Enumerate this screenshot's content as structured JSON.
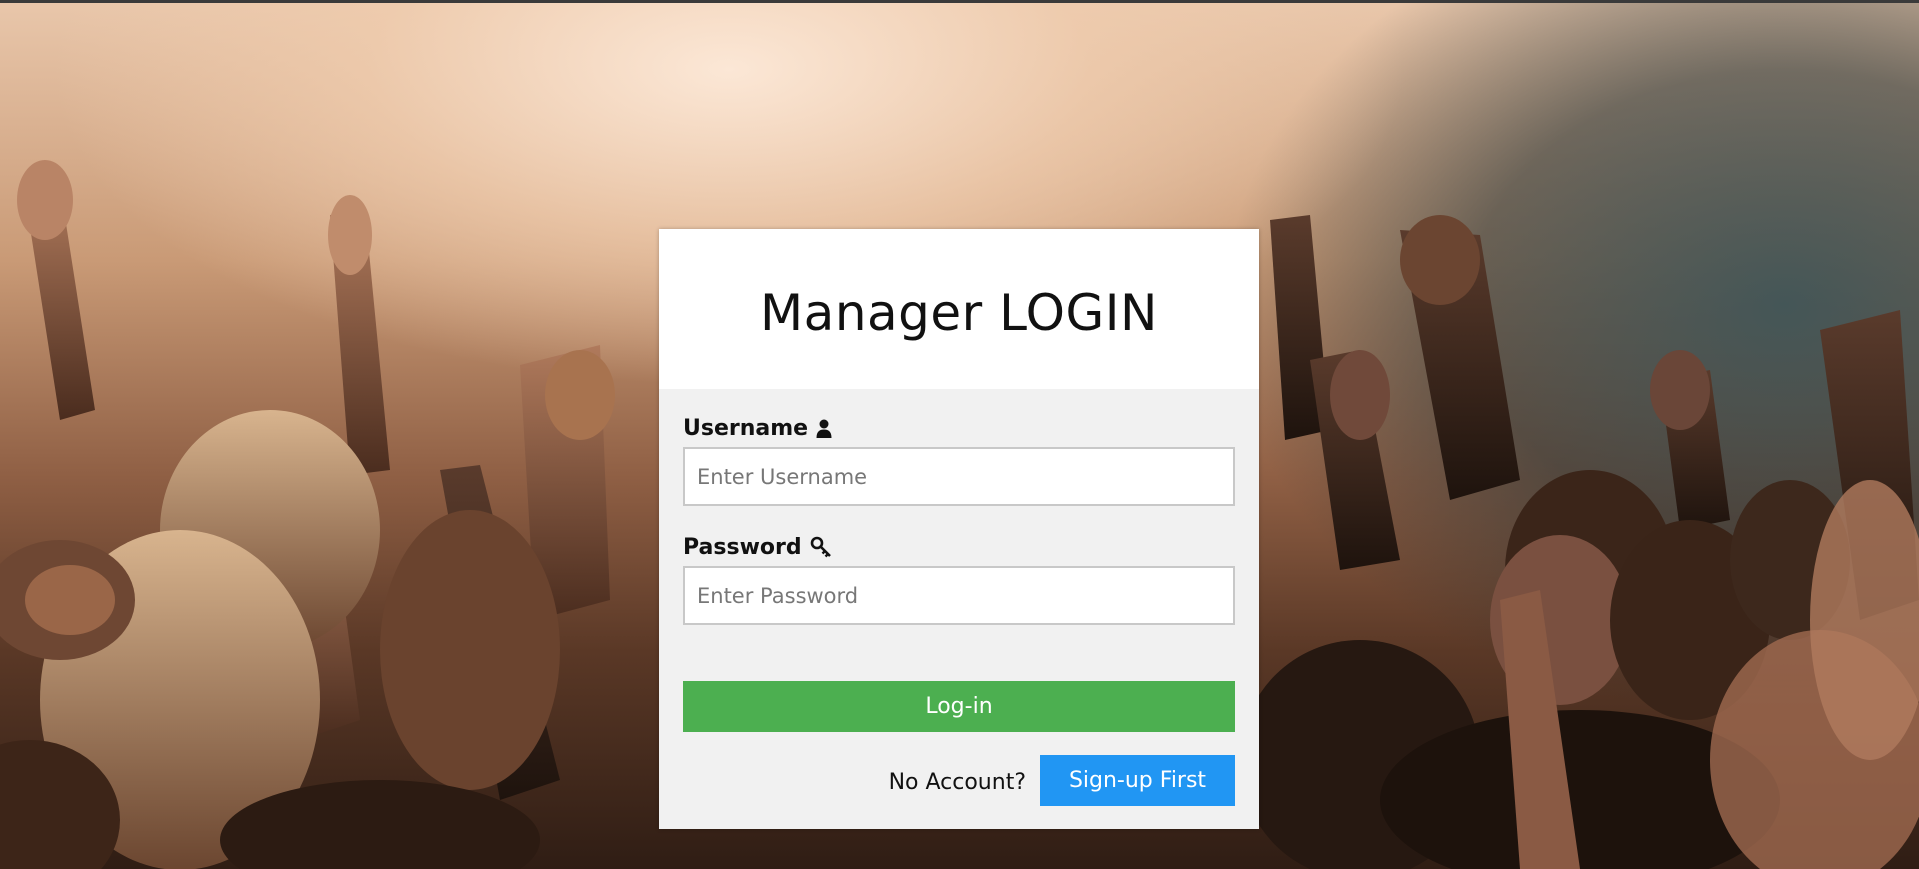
{
  "card": {
    "title": "Manager LOGIN"
  },
  "form": {
    "username_label": "Username",
    "username_icon": "user-icon",
    "username_placeholder": "Enter Username",
    "password_label": "Password",
    "password_icon": "key-icon",
    "password_placeholder": "Enter Password",
    "login_label": "Log-in"
  },
  "signup": {
    "prompt": "No Account?",
    "button_label": "Sign-up First"
  },
  "colors": {
    "login_button": "#4caf50",
    "signup_button": "#2196f3",
    "card_background": "#f1f1f1",
    "header_background": "#ffffff"
  }
}
